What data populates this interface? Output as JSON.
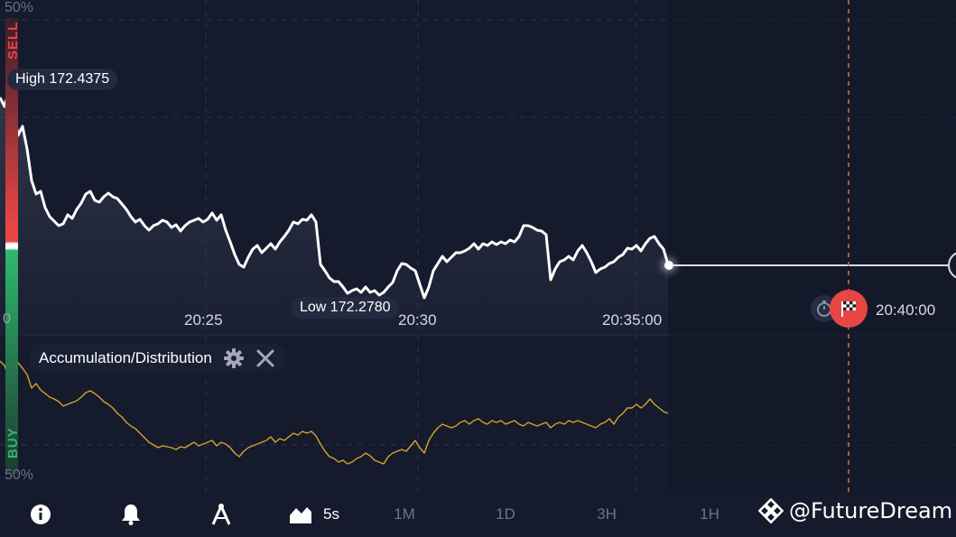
{
  "chart": {
    "high_label": "High 172.4375",
    "low_label": "Low 172.2780",
    "time_labels": [
      "20:25",
      "20:30",
      "20:35:00",
      "20:40:00"
    ],
    "left_zero": "0",
    "price_path": [
      [
        0,
        108
      ],
      [
        5,
        118
      ],
      [
        10,
        100
      ],
      [
        15,
        120
      ],
      [
        20,
        150
      ],
      [
        25,
        140
      ],
      [
        30,
        165
      ],
      [
        35,
        200
      ],
      [
        40,
        215
      ],
      [
        45,
        212
      ],
      [
        50,
        230
      ],
      [
        55,
        240
      ],
      [
        60,
        245
      ],
      [
        65,
        250
      ],
      [
        70,
        248
      ],
      [
        75,
        238
      ],
      [
        80,
        242
      ],
      [
        85,
        232
      ],
      [
        90,
        225
      ],
      [
        95,
        215
      ],
      [
        100,
        212
      ],
      [
        105,
        222
      ],
      [
        110,
        224
      ],
      [
        115,
        218
      ],
      [
        120,
        214
      ],
      [
        125,
        218
      ],
      [
        130,
        220
      ],
      [
        135,
        226
      ],
      [
        140,
        232
      ],
      [
        145,
        240
      ],
      [
        150,
        246
      ],
      [
        155,
        243
      ],
      [
        160,
        250
      ],
      [
        165,
        255
      ],
      [
        170,
        250
      ],
      [
        175,
        248
      ],
      [
        180,
        244
      ],
      [
        185,
        246
      ],
      [
        190,
        252
      ],
      [
        195,
        249
      ],
      [
        200,
        256
      ],
      [
        205,
        250
      ],
      [
        210,
        246
      ],
      [
        215,
        244
      ],
      [
        220,
        242
      ],
      [
        225,
        246
      ],
      [
        230,
        243
      ],
      [
        235,
        236
      ],
      [
        240,
        244
      ],
      [
        245,
        238
      ],
      [
        250,
        255
      ],
      [
        255,
        268
      ],
      [
        260,
        282
      ],
      [
        265,
        293
      ],
      [
        270,
        296
      ],
      [
        275,
        285
      ],
      [
        280,
        276
      ],
      [
        285,
        272
      ],
      [
        290,
        280
      ],
      [
        295,
        275
      ],
      [
        300,
        270
      ],
      [
        305,
        276
      ],
      [
        310,
        268
      ],
      [
        315,
        262
      ],
      [
        320,
        255
      ],
      [
        325,
        246
      ],
      [
        330,
        248
      ],
      [
        335,
        243
      ],
      [
        340,
        244
      ],
      [
        345,
        238
      ],
      [
        350,
        246
      ],
      [
        355,
        293
      ],
      [
        360,
        300
      ],
      [
        365,
        308
      ],
      [
        370,
        312
      ],
      [
        375,
        312
      ],
      [
        380,
        318
      ],
      [
        385,
        325
      ],
      [
        390,
        322
      ],
      [
        395,
        320
      ],
      [
        400,
        324
      ],
      [
        405,
        318
      ],
      [
        410,
        324
      ],
      [
        415,
        322
      ],
      [
        420,
        327
      ],
      [
        425,
        324
      ],
      [
        430,
        318
      ],
      [
        435,
        313
      ],
      [
        440,
        300
      ],
      [
        445,
        292
      ],
      [
        450,
        293
      ],
      [
        455,
        297
      ],
      [
        460,
        300
      ],
      [
        465,
        315
      ],
      [
        470,
        330
      ],
      [
        475,
        318
      ],
      [
        480,
        300
      ],
      [
        485,
        292
      ],
      [
        490,
        284
      ],
      [
        495,
        290
      ],
      [
        500,
        285
      ],
      [
        505,
        280
      ],
      [
        510,
        280
      ],
      [
        515,
        278
      ],
      [
        520,
        275
      ],
      [
        525,
        270
      ],
      [
        530,
        276
      ],
      [
        535,
        270
      ],
      [
        540,
        272
      ],
      [
        545,
        268
      ],
      [
        550,
        271
      ],
      [
        555,
        268
      ],
      [
        560,
        270
      ],
      [
        565,
        266
      ],
      [
        570,
        268
      ],
      [
        575,
        262
      ],
      [
        580,
        250
      ],
      [
        585,
        250
      ],
      [
        590,
        252
      ],
      [
        595,
        255
      ],
      [
        600,
        256
      ],
      [
        605,
        260
      ],
      [
        610,
        310
      ],
      [
        615,
        298
      ],
      [
        620,
        290
      ],
      [
        625,
        288
      ],
      [
        630,
        284
      ],
      [
        635,
        288
      ],
      [
        640,
        278
      ],
      [
        645,
        272
      ],
      [
        650,
        280
      ],
      [
        655,
        290
      ],
      [
        660,
        302
      ],
      [
        665,
        298
      ],
      [
        670,
        296
      ],
      [
        675,
        292
      ],
      [
        680,
        290
      ],
      [
        685,
        285
      ],
      [
        690,
        282
      ],
      [
        695,
        275
      ],
      [
        700,
        276
      ],
      [
        705,
        272
      ],
      [
        710,
        278
      ],
      [
        715,
        270
      ],
      [
        720,
        264
      ],
      [
        725,
        262
      ],
      [
        730,
        270
      ],
      [
        735,
        276
      ],
      [
        740,
        293
      ]
    ],
    "ad_path": [
      [
        0,
        400
      ],
      [
        5,
        405
      ],
      [
        10,
        420
      ],
      [
        15,
        413
      ],
      [
        20,
        402
      ],
      [
        25,
        408
      ],
      [
        30,
        415
      ],
      [
        35,
        430
      ],
      [
        40,
        425
      ],
      [
        45,
        432
      ],
      [
        50,
        436
      ],
      [
        55,
        440
      ],
      [
        60,
        442
      ],
      [
        65,
        445
      ],
      [
        70,
        450
      ],
      [
        75,
        448
      ],
      [
        80,
        446
      ],
      [
        85,
        444
      ],
      [
        90,
        440
      ],
      [
        95,
        435
      ],
      [
        100,
        433
      ],
      [
        105,
        436
      ],
      [
        110,
        440
      ],
      [
        115,
        445
      ],
      [
        120,
        448
      ],
      [
        125,
        452
      ],
      [
        130,
        458
      ],
      [
        135,
        462
      ],
      [
        140,
        468
      ],
      [
        145,
        472
      ],
      [
        150,
        475
      ],
      [
        155,
        480
      ],
      [
        160,
        485
      ],
      [
        165,
        490
      ],
      [
        170,
        493
      ],
      [
        175,
        496
      ],
      [
        180,
        494
      ],
      [
        185,
        495
      ],
      [
        190,
        496
      ],
      [
        195,
        498
      ],
      [
        200,
        495
      ],
      [
        205,
        496
      ],
      [
        210,
        493
      ],
      [
        215,
        490
      ],
      [
        220,
        494
      ],
      [
        225,
        492
      ],
      [
        230,
        490
      ],
      [
        235,
        488
      ],
      [
        240,
        494
      ],
      [
        245,
        490
      ],
      [
        250,
        492
      ],
      [
        255,
        496
      ],
      [
        260,
        502
      ],
      [
        265,
        506
      ],
      [
        270,
        500
      ],
      [
        275,
        496
      ],
      [
        280,
        494
      ],
      [
        285,
        492
      ],
      [
        290,
        490
      ],
      [
        295,
        488
      ],
      [
        300,
        484
      ],
      [
        305,
        490
      ],
      [
        310,
        486
      ],
      [
        315,
        488
      ],
      [
        320,
        484
      ],
      [
        325,
        480
      ],
      [
        330,
        482
      ],
      [
        335,
        478
      ],
      [
        340,
        480
      ],
      [
        345,
        478
      ],
      [
        350,
        483
      ],
      [
        355,
        492
      ],
      [
        360,
        500
      ],
      [
        365,
        506
      ],
      [
        370,
        508
      ],
      [
        375,
        512
      ],
      [
        380,
        510
      ],
      [
        385,
        514
      ],
      [
        390,
        512
      ],
      [
        395,
        508
      ],
      [
        400,
        506
      ],
      [
        405,
        502
      ],
      [
        410,
        505
      ],
      [
        415,
        510
      ],
      [
        420,
        512
      ],
      [
        425,
        514
      ],
      [
        430,
        506
      ],
      [
        435,
        502
      ],
      [
        440,
        500
      ],
      [
        445,
        498
      ],
      [
        450,
        500
      ],
      [
        455,
        494
      ],
      [
        460,
        488
      ],
      [
        465,
        496
      ],
      [
        470,
        502
      ],
      [
        475,
        488
      ],
      [
        480,
        480
      ],
      [
        485,
        474
      ],
      [
        490,
        470
      ],
      [
        495,
        472
      ],
      [
        500,
        474
      ],
      [
        505,
        472
      ],
      [
        510,
        468
      ],
      [
        515,
        466
      ],
      [
        520,
        470
      ],
      [
        525,
        466
      ],
      [
        530,
        464
      ],
      [
        535,
        468
      ],
      [
        540,
        470
      ],
      [
        545,
        466
      ],
      [
        550,
        468
      ],
      [
        555,
        466
      ],
      [
        560,
        470
      ],
      [
        565,
        468
      ],
      [
        570,
        466
      ],
      [
        575,
        470
      ],
      [
        580,
        472
      ],
      [
        585,
        468
      ],
      [
        590,
        470
      ],
      [
        595,
        472
      ],
      [
        600,
        470
      ],
      [
        605,
        468
      ],
      [
        610,
        474
      ],
      [
        615,
        470
      ],
      [
        620,
        468
      ],
      [
        625,
        470
      ],
      [
        630,
        466
      ],
      [
        635,
        468
      ],
      [
        640,
        466
      ],
      [
        645,
        468
      ],
      [
        650,
        470
      ],
      [
        655,
        472
      ],
      [
        660,
        474
      ],
      [
        665,
        470
      ],
      [
        670,
        468
      ],
      [
        675,
        464
      ],
      [
        680,
        470
      ],
      [
        685,
        462
      ],
      [
        690,
        458
      ],
      [
        695,
        452
      ],
      [
        700,
        452
      ],
      [
        705,
        448
      ],
      [
        710,
        452
      ],
      [
        715,
        448
      ],
      [
        720,
        442
      ],
      [
        725,
        448
      ],
      [
        730,
        452
      ],
      [
        735,
        456
      ],
      [
        740,
        458
      ]
    ]
  },
  "side": {
    "top_pct": "50%",
    "bottom_pct": "50%",
    "sell_label": "SELL",
    "buy_label": "BUY",
    "sell_color": "#e84545",
    "buy_color": "#2fb86b"
  },
  "indicator": {
    "name": "Accumulation/Distribution",
    "settings_icon": "gear-icon",
    "close_icon": "close-icon"
  },
  "toolbar": {
    "info_icon": "info-icon",
    "alert_icon": "bell-icon",
    "drawing_icon": "compass-icon",
    "chart_type_icon": "area-chart-icon",
    "timeframes": [
      "5s",
      "1M",
      "1D",
      "3H",
      "1H"
    ],
    "active_timeframe": "5s"
  },
  "watermark": {
    "text": "@FutureDream",
    "icon": "binance-logo-icon"
  },
  "colors": {
    "background": "#151a2c",
    "price_line": "#ffffff",
    "indicator_line": "#d4a52a",
    "expiry_line": "#c9764a"
  }
}
